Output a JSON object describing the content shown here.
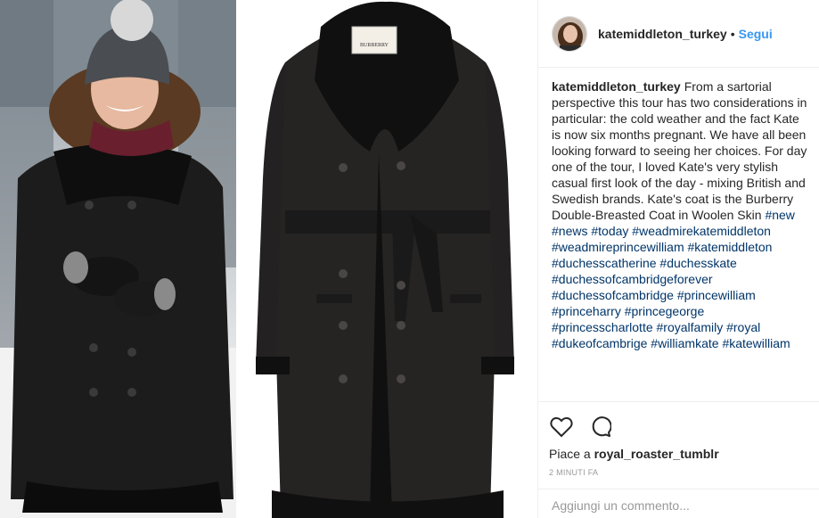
{
  "post": {
    "username": "katemiddleton_turkey",
    "follow_label": "Segui",
    "caption_text": "From a sartorial perspective this tour has two considerations in particular: the cold weather and the fact Kate is now six months pregnant. We have all been looking forward to seeing her choices. For day one of the tour, I loved Kate's very stylish casual first look of the day - mixing British and Swedish brands. Kate's coat is the Burberry Double-Breasted Coat in Woolen Skin",
    "hashtags": [
      "#new",
      "#news",
      "#today",
      "#weadmirekatemiddleton",
      "#weadmireprincewilliam",
      "#katemiddleton",
      "#duchesscatherine",
      "#duchesskate",
      "#duchessofcambridgeforever",
      "#duchessofcambridge",
      "#princewilliam",
      "#princeharry",
      "#princegeorge",
      "#princesscharlotte",
      "#royalfamily",
      "#royal",
      "#dukeofcambrige",
      "#williamkate",
      "#katewilliam"
    ],
    "likes_prefix": "Piace a",
    "liked_by": "royal_roaster_tumblr",
    "time_ago": "2 MINUTI FA",
    "comment_placeholder": "Aggiungi un commento..."
  },
  "media": {
    "coat_label_text": "BURBERRY"
  },
  "colors": {
    "link_blue": "#3897f0",
    "hashtag": "#003569",
    "coat": "#262423"
  }
}
